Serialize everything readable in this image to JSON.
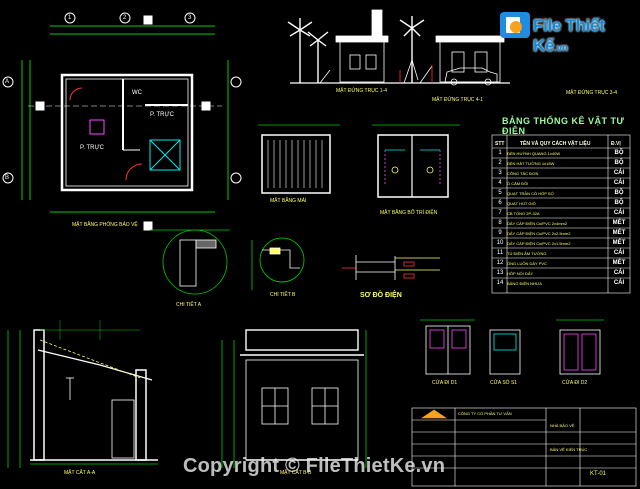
{
  "logo": {
    "brand": "File Thiết Kế",
    "domain": ".vn",
    "icon": "file-folder-icon"
  },
  "watermark": {
    "text": "Copyright © FileThietKe.vn"
  },
  "material_table": {
    "title": "BẢNG THỐNG KÊ VẬT TƯ ĐIỆN",
    "headers": {
      "number": "STT",
      "description": "TÊN VÀ QUY CÁCH VẬT LIỆU",
      "unit": "Đ.VỊ"
    },
    "rows": [
      {
        "n": "1",
        "desc": "ĐÈN HUỲNH QUANG 1x40W",
        "unit": "BỘ"
      },
      {
        "n": "2",
        "desc": "ĐÈN HẮT TƯỜNG 1x18W",
        "unit": "BỘ"
      },
      {
        "n": "3",
        "desc": "CÔNG TẮC ĐƠN",
        "unit": "CÁI"
      },
      {
        "n": "4",
        "desc": "Ổ CẮM ĐÔI",
        "unit": "CÁI"
      },
      {
        "n": "5",
        "desc": "QUẠT TRẦN CÓ HỘP SỐ",
        "unit": "BỘ"
      },
      {
        "n": "6",
        "desc": "QUẠT HÚT GIÓ",
        "unit": "BỘ"
      },
      {
        "n": "7",
        "desc": "CB TỔNG 2P-32A",
        "unit": "CÁI"
      },
      {
        "n": "8",
        "desc": "DÂY CÁP ĐIỆN Cu/PVC 2x4mm2",
        "unit": "MÉT"
      },
      {
        "n": "9",
        "desc": "DÂY CÁP ĐIỆN Cu/PVC 2x2.5mm2",
        "unit": "MÉT"
      },
      {
        "n": "10",
        "desc": "DÂY CÁP ĐIỆN Cu/PVC 2x1.5mm2",
        "unit": "MÉT"
      },
      {
        "n": "11",
        "desc": "TỦ ĐIỆN ÂM TƯỜNG",
        "unit": "CÁI"
      },
      {
        "n": "12",
        "desc": "ỐNG LUỒN DÂY PVC",
        "unit": "MÉT"
      },
      {
        "n": "13",
        "desc": "HỘP NỐI DÂY",
        "unit": "CÁI"
      },
      {
        "n": "14",
        "desc": "BẢNG ĐIỆN NHỰA",
        "unit": "CÁI"
      }
    ]
  },
  "captions": {
    "plan": "MẶT BẰNG PHÒNG BẢO VỆ",
    "elev_front": "MẶT ĐỨNG TRỤC 1-4",
    "elev_side": "MẶT ĐỨNG TRỤC 4-1",
    "elev_back": "MẶT ĐỨNG TRỤC 3-4",
    "roof": "MẶT BẰNG MÁI",
    "electric_plan": "MẶT BẰNG BỐ TRÍ ĐIỆN",
    "schematic": "SƠ ĐỒ ĐIỆN",
    "detail_a": "CHI TIẾT A",
    "detail_b": "CHI TIẾT B",
    "section_a": "MẶT CẮT A-A",
    "section_b": "MẶT CẮT B-B",
    "door1": "CỬA ĐI D1",
    "door2": "CỬA SỔ S1",
    "door3": "CỬA ĐI D2"
  },
  "rooms": {
    "guard": "P. TRỰC",
    "wc": "WC",
    "left": "P. TRỰC"
  },
  "grid_labels": [
    "A",
    "B",
    "1",
    "2",
    "3"
  ],
  "title_block": {
    "company": "CÔNG TY CỔ PHẦN TƯ VẤN",
    "project": "NHÀ BẢO VỆ",
    "drawing": "BẢN VẼ KIẾN TRÚC",
    "sheet": "KT-01"
  },
  "colors": {
    "background": "#000000",
    "wall": "#ffffff",
    "dim": "#00d000",
    "text": "#ffff66",
    "red": "#ff3030",
    "cyan": "#00e0e0",
    "magenta": "#ff40ff",
    "logo": "#0a8ddf"
  }
}
